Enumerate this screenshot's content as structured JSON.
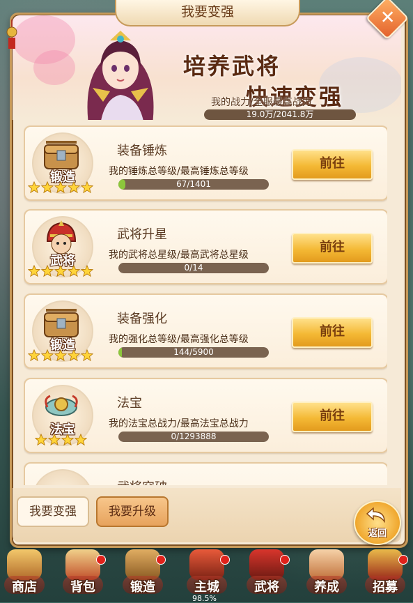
{
  "window": {
    "title": "我要变强",
    "close_label": "✕"
  },
  "banner": {
    "slogan_line1": "培养武将",
    "slogan_line2": "快速变强",
    "power_label": "我的战力/全服最高战力",
    "power_value": "19.0万/2041.8万"
  },
  "cards": [
    {
      "title": "装备锤炼",
      "desc": "我的锤炼总等级/最高锤炼总等级",
      "progress": "67/1401",
      "ratio": 0.048,
      "icon_caption": "锻造",
      "icon": "forge-chest-icon",
      "stars": 5,
      "button": "前往"
    },
    {
      "title": "武将升星",
      "desc": "我的武将总星级/最高武将总星级",
      "progress": "0/14",
      "ratio": 0,
      "icon_caption": "武将",
      "icon": "general-helmet-icon",
      "stars": 5,
      "button": "前往"
    },
    {
      "title": "装备强化",
      "desc": "我的强化总等级/最高强化总等级",
      "progress": "144/5900",
      "ratio": 0.024,
      "icon_caption": "锻造",
      "icon": "forge-chest-icon",
      "stars": 5,
      "button": "前往"
    },
    {
      "title": "法宝",
      "desc": "我的法宝总战力/最高法宝总战力",
      "progress": "0/1293888",
      "ratio": 0,
      "icon_caption": "法宝",
      "icon": "treasure-icon",
      "stars": 4,
      "button": "前往"
    },
    {
      "title": "武将突破",
      "partial": true
    }
  ],
  "sub_tabs": [
    {
      "label": "我要变强",
      "active": false
    },
    {
      "label": "我要升级",
      "active": true
    }
  ],
  "back_button": {
    "label": "返回"
  },
  "bottom_nav": [
    {
      "label": "商店",
      "icon": "shop-icon",
      "badge": false
    },
    {
      "label": "背包",
      "icon": "bag-icon",
      "badge": true
    },
    {
      "label": "锻造",
      "icon": "forge-icon",
      "badge": true
    },
    {
      "label": "主城",
      "icon": "city-icon",
      "badge": true
    },
    {
      "label": "武将",
      "icon": "general-icon",
      "badge": true
    },
    {
      "label": "养成",
      "icon": "cultivate-icon",
      "badge": false
    },
    {
      "label": "招募",
      "icon": "recruit-icon",
      "badge": true
    }
  ],
  "loading_percent": "98.5%",
  "colors": {
    "accent": "#f4b935",
    "progress_fill": "#8cc63c",
    "panel": "#f6ead7",
    "brown_text": "#5a3a22"
  }
}
